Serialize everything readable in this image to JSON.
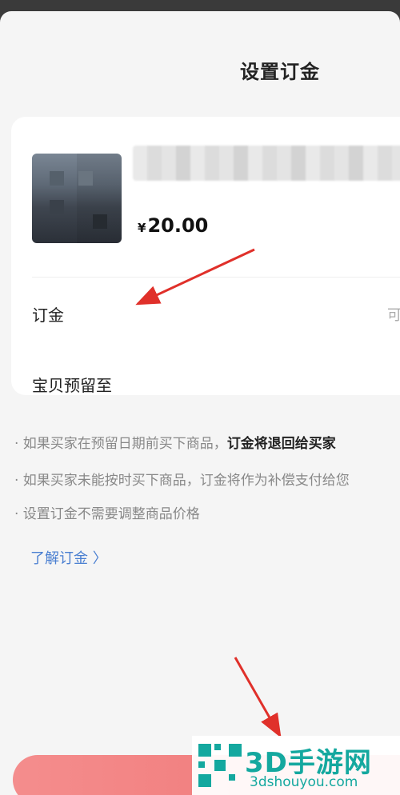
{
  "sheet": {
    "title": "设置订金"
  },
  "product": {
    "price_symbol": "¥",
    "price_value": "20.00"
  },
  "rows": [
    {
      "label": "订金",
      "value": "可"
    },
    {
      "label": "宝贝预留至",
      "value": ""
    }
  ],
  "notes": [
    {
      "prefix": "· 如果买家在预留日期前买下商品，",
      "bold": "订金将退回给买家"
    },
    {
      "prefix": "· 如果买家未能按时买下商品，订金将作为补偿支付给您",
      "bold": ""
    },
    {
      "prefix": "· 设置订金不需要调整商品价格",
      "bold": ""
    }
  ],
  "learn_link": "了解订金 〉",
  "watermark": {
    "name": "3D手游网",
    "url": "3dshouyou.com"
  },
  "colors": {
    "link": "#4a7fd1",
    "button": "#f28080",
    "annotation_arrow": "#e0302a",
    "watermark": "#14a89f"
  }
}
